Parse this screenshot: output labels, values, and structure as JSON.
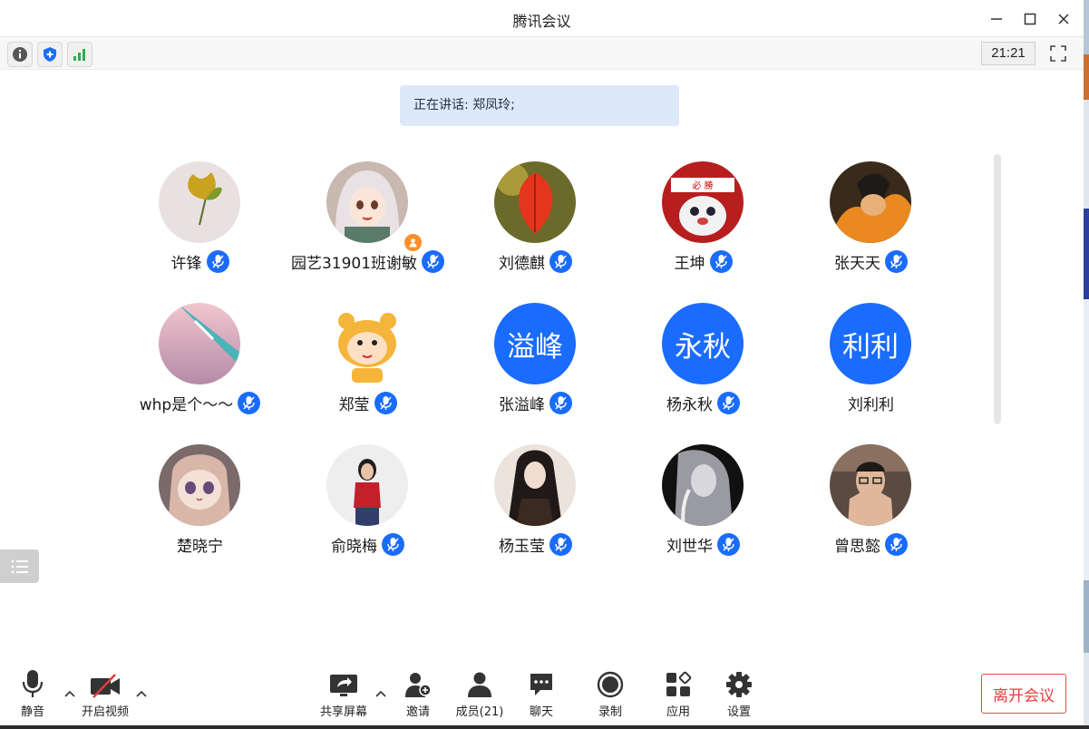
{
  "window": {
    "title": "腾讯会议"
  },
  "infobar": {
    "clock": "21:21"
  },
  "speaking": {
    "label": "正在讲话: 郑凤玲;"
  },
  "participants": [
    {
      "name": "许锋",
      "avatar": "photo-ginkgo-leaf",
      "mic": true
    },
    {
      "name": "园艺31901班谢敏",
      "avatar": "photo-anime-girl",
      "mic": true,
      "host": true
    },
    {
      "name": "刘德麒",
      "avatar": "photo-red-leaf",
      "mic": true
    },
    {
      "name": "王坤",
      "avatar": "photo-cartoon-headband",
      "mic": true
    },
    {
      "name": "张天天",
      "avatar": "photo-anime-fire",
      "mic": true
    },
    {
      "name": "whp是个～～",
      "avatar": "photo-airplane-wing",
      "mic": true
    },
    {
      "name": "郑莹",
      "avatar": "photo-tiger-sticker",
      "mic": true
    },
    {
      "name": "张溢峰",
      "avatar_text": "溢峰",
      "mic": true
    },
    {
      "name": "杨永秋",
      "avatar_text": "永秋",
      "mic": true
    },
    {
      "name": "刘利利",
      "avatar_text": "利利",
      "mic": false
    },
    {
      "name": "楚晓宁",
      "avatar": "photo-cat-doll",
      "mic": false
    },
    {
      "name": "俞晓梅",
      "avatar": "photo-girl-red",
      "mic": true
    },
    {
      "name": "杨玉莹",
      "avatar": "photo-ancient-character",
      "mic": true
    },
    {
      "name": "刘世华",
      "avatar": "photo-bw-portrait",
      "mic": true
    },
    {
      "name": "曾思懿",
      "avatar": "photo-boy-glasses",
      "mic": true
    }
  ],
  "toolbar": {
    "mute": "静音",
    "video": "开启视频",
    "share": "共享屏幕",
    "invite": "邀请",
    "members": "成员(21)",
    "chat": "聊天",
    "record": "录制",
    "apps": "应用",
    "settings": "设置",
    "leave": "离开会议"
  },
  "colors": {
    "accent": "#1a6cff",
    "leave": "#e04141",
    "host": "#ff8d2a"
  }
}
